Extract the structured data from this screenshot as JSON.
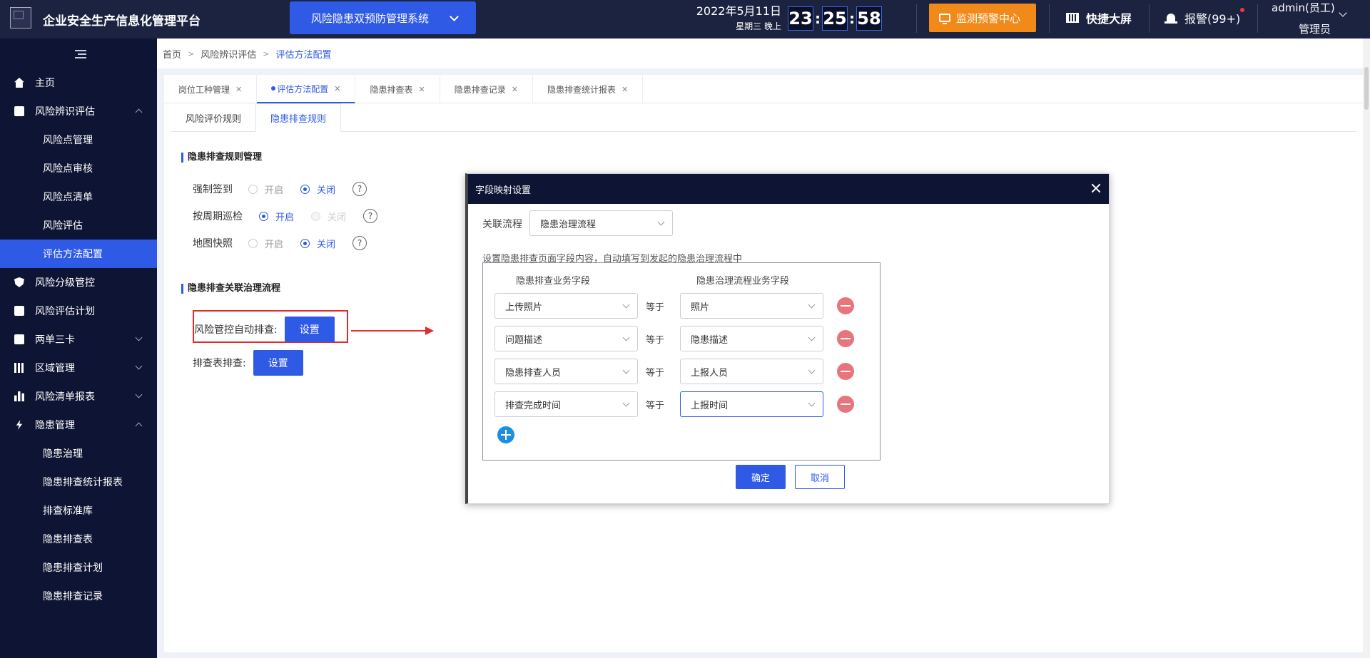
{
  "header": {
    "app_title": "企业安全生产信息化管理平台",
    "system_select": "风险隐患双预防管理系统",
    "date": "2022年5月11日",
    "weekday": "星期三  晚上",
    "clock": {
      "hh": "23",
      "mm": "25",
      "ss": "58"
    },
    "monitor_button": "监测预警中心",
    "quick_screen": "快捷大屏",
    "alarm": "报警(99+)",
    "user_name": "admin(员工)",
    "user_role": "管理员",
    "colors": {
      "bar": "#1c2340",
      "accent": "#2f5ae5",
      "orange": "#f28a1a"
    }
  },
  "sidebar": {
    "items": [
      {
        "label": "主页",
        "icon": "home-icon"
      },
      {
        "label": "风险辨识评估",
        "icon": "edit-icon",
        "expanded": true
      },
      {
        "label": "风险点管理",
        "sub": true
      },
      {
        "label": "风险点审核",
        "sub": true
      },
      {
        "label": "风险点清单",
        "sub": true
      },
      {
        "label": "风险评估",
        "sub": true
      },
      {
        "label": "评估方法配置",
        "sub": true,
        "active": true
      },
      {
        "label": "风险分级管控",
        "icon": "shield-icon"
      },
      {
        "label": "风险评估计划",
        "icon": "plan-icon"
      },
      {
        "label": "两单三卡",
        "icon": "clipboard-icon",
        "expanded": false
      },
      {
        "label": "区域管理",
        "icon": "columns-icon",
        "expanded": false
      },
      {
        "label": "风险清单报表",
        "icon": "bar-chart-icon",
        "expanded": false
      },
      {
        "label": "隐患管理",
        "icon": "bolt-icon",
        "expanded": true
      },
      {
        "label": "隐患治理",
        "sub": true
      },
      {
        "label": "隐患排查统计报表",
        "sub": true
      },
      {
        "label": "排查标准库",
        "sub": true
      },
      {
        "label": "隐患排查表",
        "sub": true
      },
      {
        "label": "隐患排查计划",
        "sub": true
      },
      {
        "label": "隐患排查记录",
        "sub": true
      }
    ]
  },
  "breadcrumb": [
    "首页",
    "风险辨识评估",
    "评估方法配置"
  ],
  "tabs": [
    "岗位工种管理",
    "评估方法配置",
    "隐患排查表",
    "隐患排查记录",
    "隐患排查统计报表"
  ],
  "subtabs": [
    "风险评价规则",
    "隐患排查规则"
  ],
  "rules": {
    "section_title": "隐患排查规则管理",
    "rows": [
      {
        "label": "强制签到",
        "opt1": "开启",
        "opt2": "关闭",
        "selected": "关闭"
      },
      {
        "label": "按周期巡检",
        "opt1": "开启",
        "opt2": "关闭",
        "selected": "开启"
      },
      {
        "label": "地图快照",
        "opt1": "开启",
        "opt2": "关闭",
        "selected": "关闭"
      }
    ],
    "help": "?"
  },
  "flow": {
    "section_title": "隐患排查关联治理流程",
    "auto_label": "风险管控自动排查:",
    "table_label": "排查表排查:",
    "set_button": "设置"
  },
  "modal": {
    "title": "字段映射设置",
    "flow_label": "关联流程",
    "flow_value": "隐患治理流程",
    "hint": "设置隐患排查页面字段内容，自动填写到发起的隐患治理流程中",
    "left_header": "隐患排查业务字段",
    "right_header": "隐患治理流程业务字段",
    "equals": "等于",
    "mappings": [
      {
        "left": "上传照片",
        "right": "照片"
      },
      {
        "left": "问题描述",
        "right": "隐患描述"
      },
      {
        "left": "隐患排查人员",
        "right": "上报人员"
      },
      {
        "left": "排查完成时间",
        "right": "上报时间"
      }
    ],
    "confirm": "确定",
    "cancel": "取消"
  }
}
